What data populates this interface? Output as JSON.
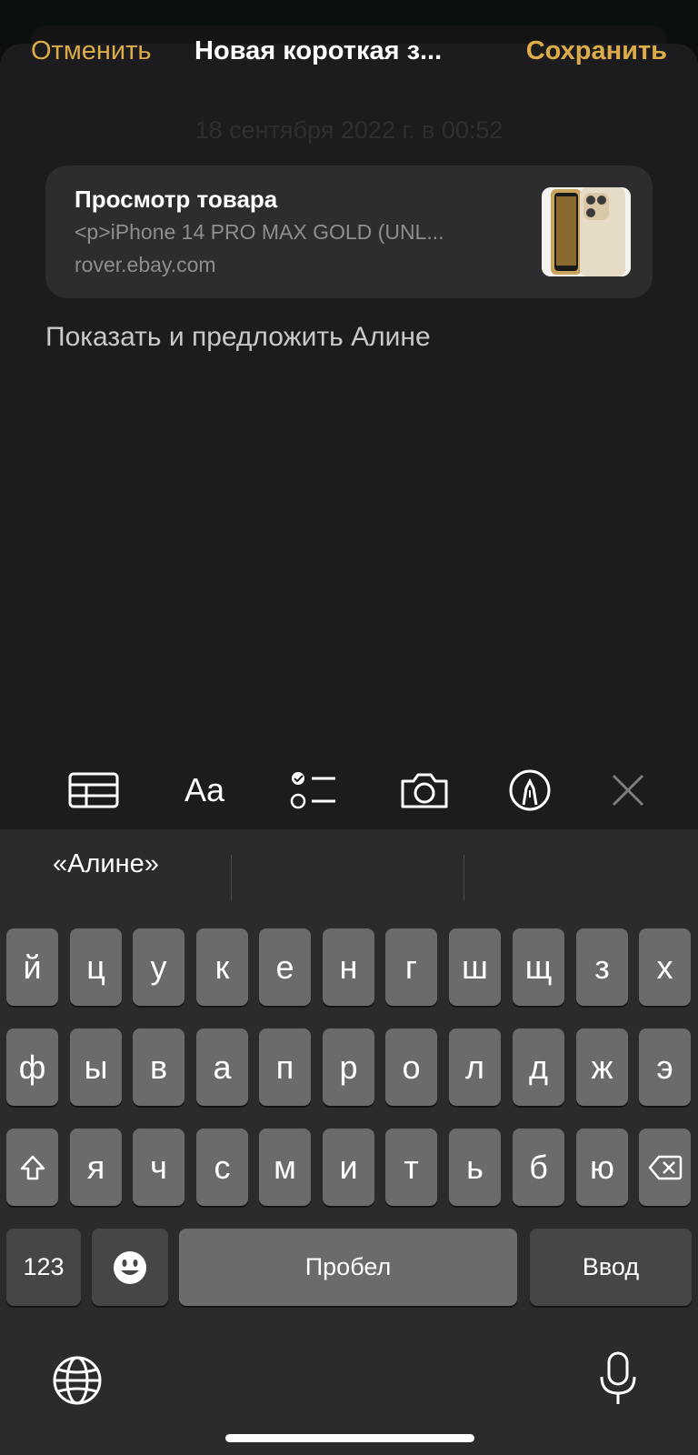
{
  "nav": {
    "cancel": "Отменить",
    "title": "Новая короткая з...",
    "save": "Сохранить"
  },
  "date_line": "18 сентября 2022 г. в 00:52",
  "link_card": {
    "title": "Просмотр товара",
    "description": "<p>iPhone 14 PRO MAX GOLD (UNL...",
    "domain": "rover.ebay.com",
    "thumbnail_icon": "iphone-gold-thumbnail"
  },
  "note_text": "Показать и предложить Алине",
  "toolbar": {
    "items": [
      "table-icon",
      "Aa",
      "checklist-icon",
      "camera-icon",
      "markup-pen-icon",
      "close-icon"
    ],
    "format_label": "Aa"
  },
  "keyboard": {
    "suggestions": [
      "«Алине»",
      "",
      ""
    ],
    "row1": [
      "й",
      "ц",
      "у",
      "к",
      "е",
      "н",
      "г",
      "ш",
      "щ",
      "з",
      "х"
    ],
    "row2": [
      "ф",
      "ы",
      "в",
      "а",
      "п",
      "р",
      "о",
      "л",
      "д",
      "ж",
      "э"
    ],
    "row3": [
      "я",
      "ч",
      "с",
      "м",
      "и",
      "т",
      "ь",
      "б",
      "ю"
    ],
    "numbers_key": "123",
    "space_key": "Пробел",
    "return_key": "Ввод",
    "shift_icon": "shift-icon",
    "delete_icon": "delete-icon",
    "emoji_icon": "emoji-icon",
    "globe_icon": "globe-icon",
    "mic_icon": "microphone-icon"
  },
  "colors": {
    "accent": "#dcac49",
    "sheet_bg": "#1c1c1e",
    "card_bg": "#2d2d2f",
    "keyboard_bg": "#2b2b2d",
    "key_bg": "#6b6b6d",
    "key_dark_bg": "#464648"
  }
}
